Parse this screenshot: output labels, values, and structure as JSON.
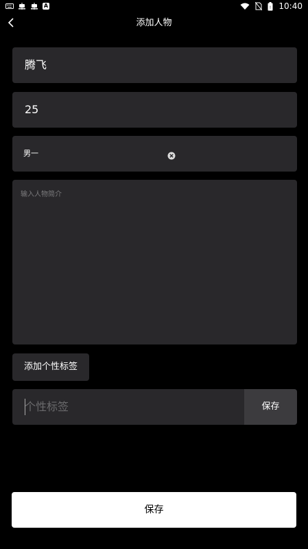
{
  "status_bar": {
    "time": "10:40",
    "icons": [
      "keyboard-icon",
      "bug-icon",
      "bug-icon",
      "a-badge-icon",
      "wifi-icon",
      "no-sim-icon",
      "battery-icon"
    ]
  },
  "header": {
    "title": "添加人物",
    "back_icon": "chevron-left-icon"
  },
  "form": {
    "name_value": "腾飞",
    "age_value": "25",
    "role_value": "男一",
    "intro_placeholder": "输入人物简介",
    "add_tag_label": "添加个性标签",
    "tag_input_placeholder": "个性标签",
    "tag_save_label": "保存"
  },
  "footer": {
    "save_label": "保存"
  },
  "colors": {
    "background": "#000000",
    "field_bg": "#29282b",
    "tag_save_bg": "#3c3b3e",
    "primary_button_bg": "#ffffff"
  }
}
